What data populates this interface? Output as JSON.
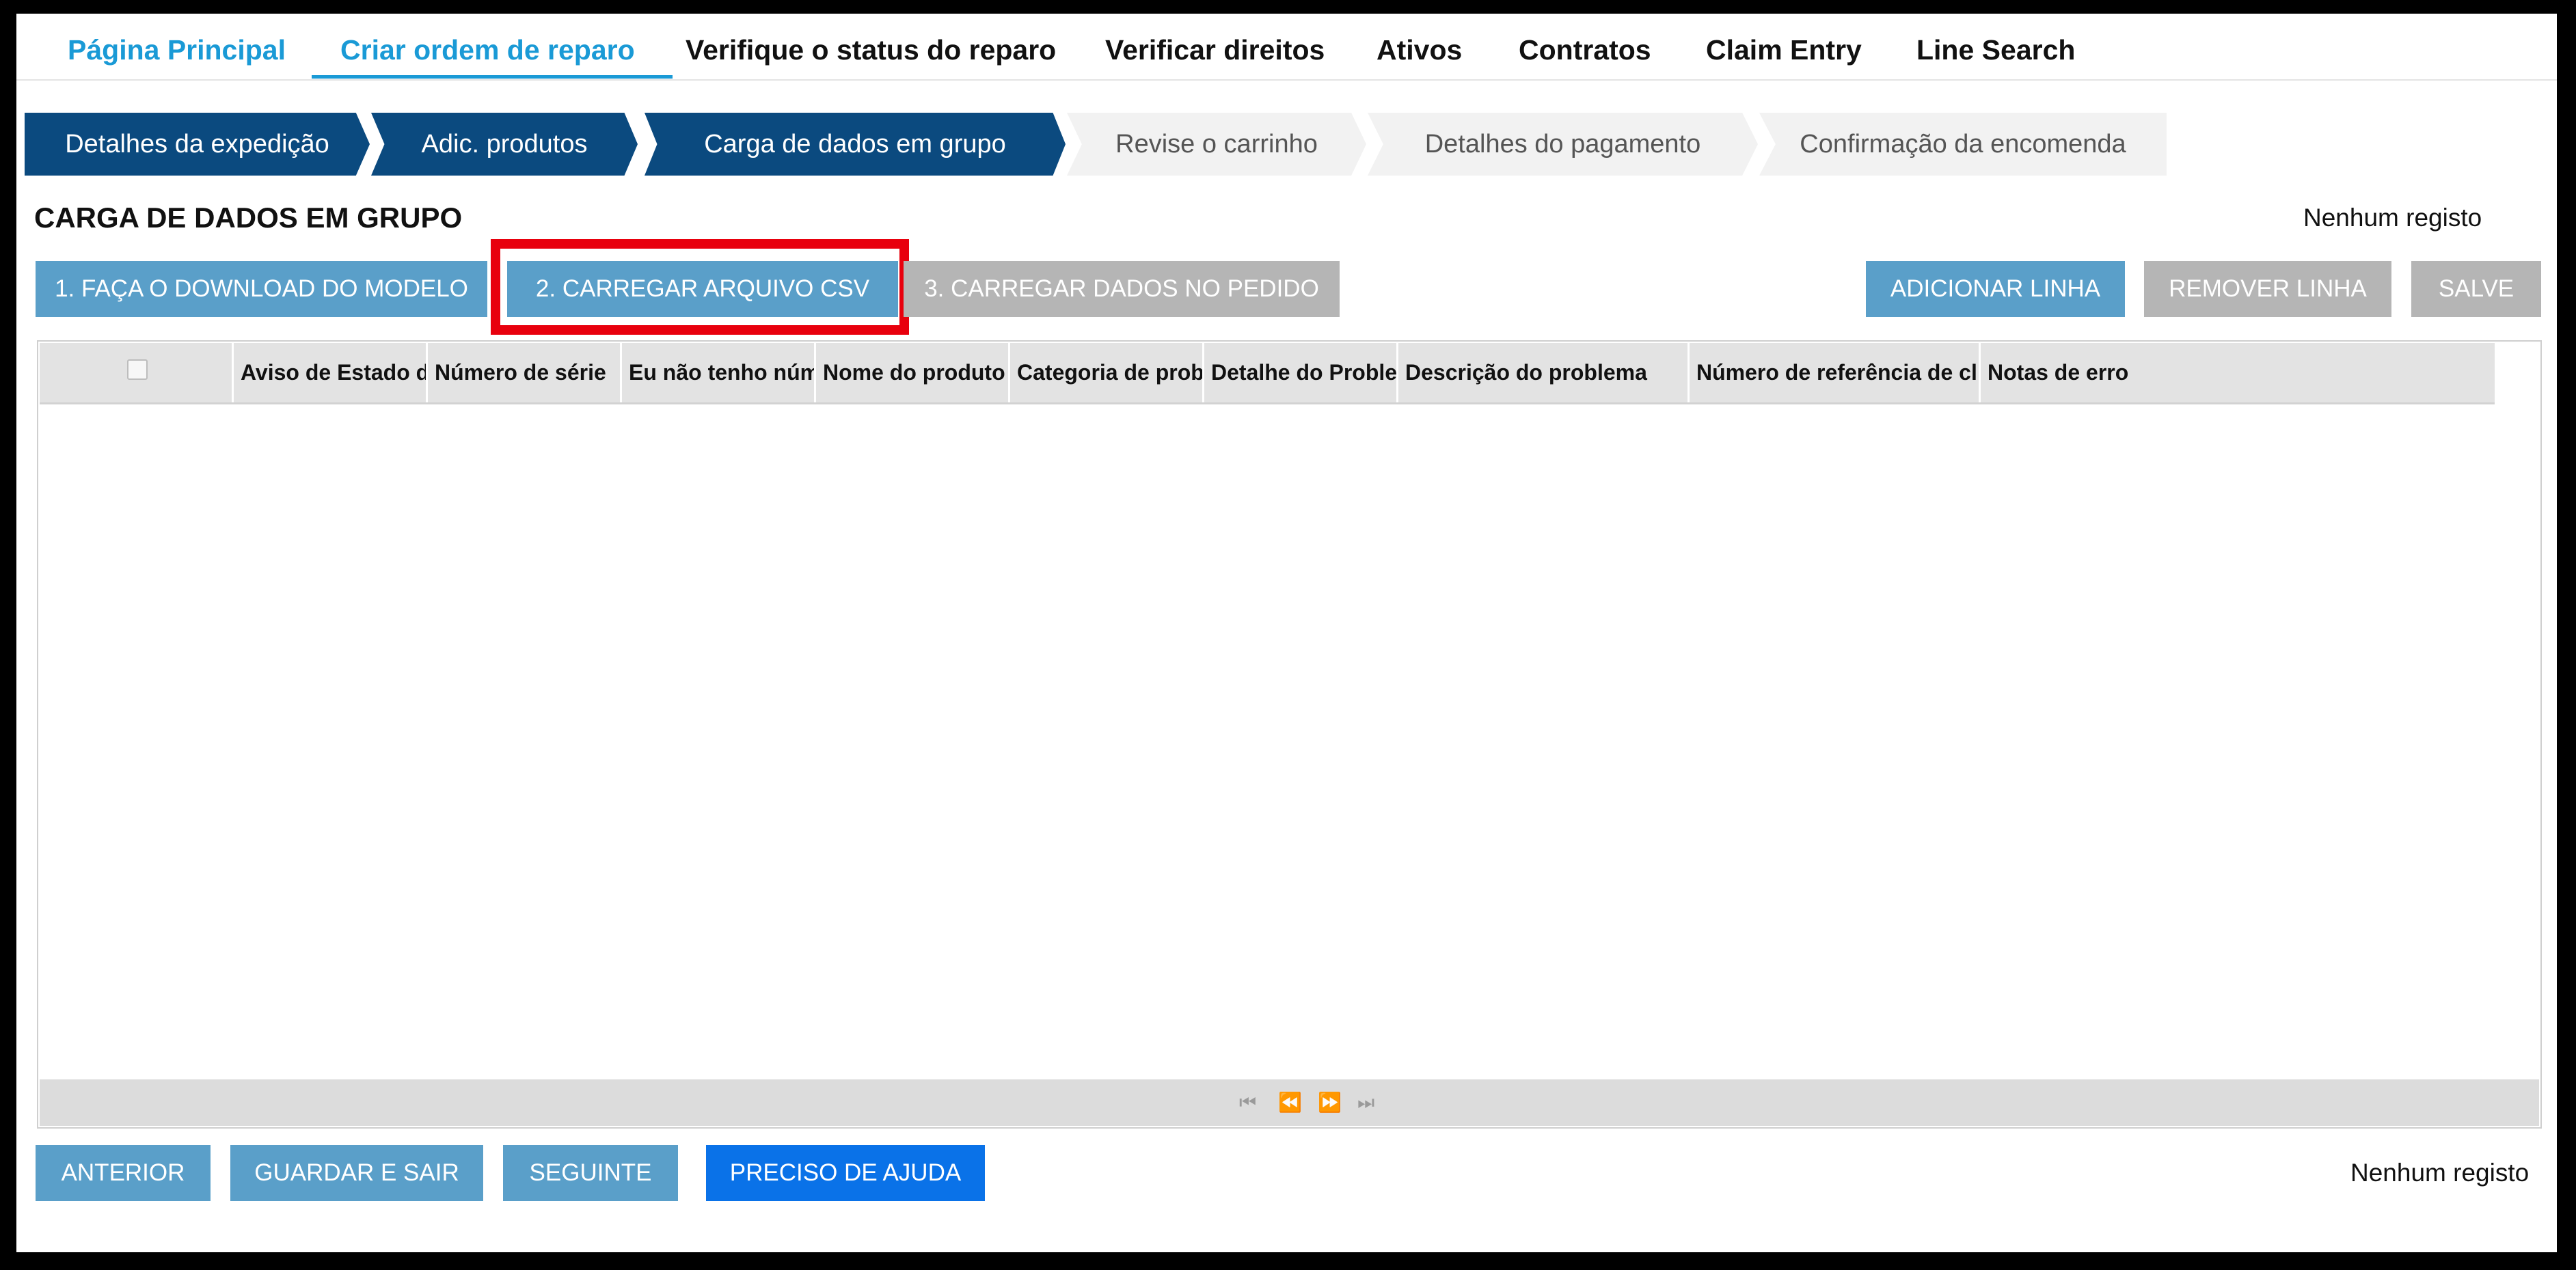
{
  "nav": {
    "items": [
      {
        "label": "Página Principal"
      },
      {
        "label": "Criar ordem de reparo"
      },
      {
        "label": "Verifique o status do reparo"
      },
      {
        "label": "Verificar direitos"
      },
      {
        "label": "Ativos"
      },
      {
        "label": "Contratos"
      },
      {
        "label": "Claim Entry"
      },
      {
        "label": "Line Search"
      }
    ]
  },
  "steps": [
    {
      "label": "Detalhes da expedição",
      "state": "complete"
    },
    {
      "label": "Adic. produtos",
      "state": "complete"
    },
    {
      "label": "Carga de dados em grupo",
      "state": "current"
    },
    {
      "label": "Revise o carrinho",
      "state": "pending"
    },
    {
      "label": "Detalhes do pagamento",
      "state": "pending"
    },
    {
      "label": "Confirmação da encomenda",
      "state": "pending"
    }
  ],
  "section": {
    "title": "CARGA DE DADOS EM GRUPO",
    "record_status": "Nenhum registo"
  },
  "actions": {
    "download_template": "1. FAÇA O DOWNLOAD DO MODELO",
    "upload_csv": "2. CARREGAR ARQUIVO CSV",
    "load_into_order": "3. CARREGAR DADOS NO PEDIDO",
    "add_line": "ADICIONAR LINHA",
    "remove_line": "REMOVER LINHA",
    "save": "SALVE"
  },
  "grid": {
    "columns": [
      "Aviso de Estado do",
      "Número de série",
      "Eu não tenho número",
      "Nome do produto",
      "Categoria de problema",
      "Detalhe do Problema",
      "Descrição do problema",
      "Número de referência de cliente",
      "Notas de erro"
    ],
    "rows": []
  },
  "footer": {
    "previous": "ANTERIOR",
    "save_exit": "GUARDAR E SAIR",
    "next": "SEGUINTE",
    "help": "PRECISO DE AJUDA",
    "record_status": "Nenhum registo"
  },
  "colors": {
    "nav_active": "#1a9ad6",
    "step_active": "#0b4a7f",
    "button_blue": "#5a9fc9",
    "button_disabled": "#b5b5b5",
    "button_help": "#0a72e8",
    "highlight": "#e8000d"
  }
}
